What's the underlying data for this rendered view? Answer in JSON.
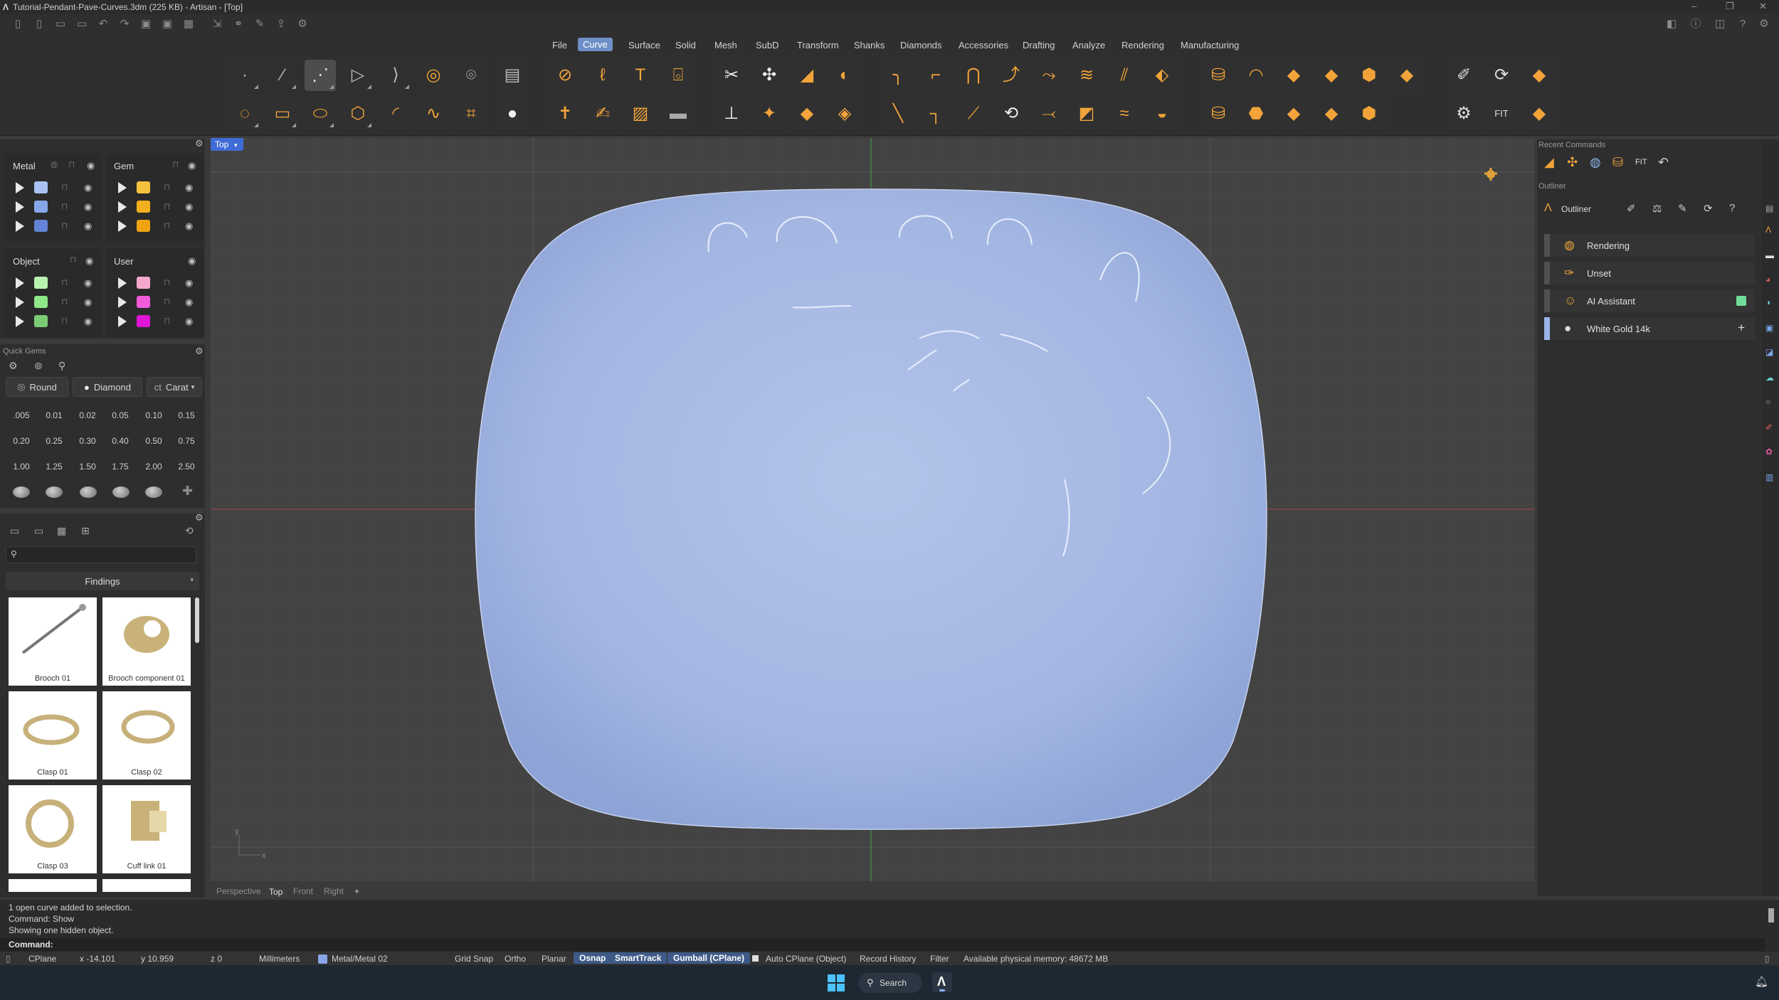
{
  "window": {
    "title": "Tutorial-Pendant-Pave-Curves.3dm (225 KB) - Artisan - [Top]",
    "app_logo": "artisan-logo"
  },
  "menu": {
    "items": [
      "File",
      "Curve",
      "Surface",
      "Solid",
      "Mesh",
      "SubD",
      "Transform",
      "Shanks",
      "Diamonds",
      "Accessories",
      "Drafting",
      "Analyze",
      "Rendering",
      "Manufacturing"
    ],
    "active": "Curve"
  },
  "layers": {
    "metal": {
      "title": "Metal",
      "colors": [
        "#a9c2f2",
        "#86a8ea",
        "#6384d6"
      ]
    },
    "gem": {
      "title": "Gem",
      "colors": [
        "#f6c23e",
        "#f2b01e",
        "#f0a414"
      ]
    },
    "object": {
      "title": "Object",
      "colors": [
        "#b8f3b0",
        "#8fe887",
        "#7ccc74"
      ]
    },
    "user": {
      "title": "User",
      "colors": [
        "#f5a8cc",
        "#f05bd9",
        "#e014d4"
      ]
    }
  },
  "quick_gems": {
    "title": "Quick Gems",
    "shape": "Round",
    "material": "Diamond",
    "unit": "Carat",
    "sizes": [
      ".005",
      "0.01",
      "0.02",
      "0.05",
      "0.10",
      "0.15",
      "0.20",
      "0.25",
      "0.30",
      "0.40",
      "0.50",
      "0.75",
      "1.00",
      "1.25",
      "1.50",
      "1.75",
      "2.00",
      "2.50"
    ]
  },
  "library": {
    "category": "Findings",
    "items": [
      "Brooch 01",
      "Brooch component 01",
      "Clasp 01",
      "Clasp 02",
      "Clasp 03",
      "Cuff link 01"
    ]
  },
  "viewport": {
    "name": "Top",
    "tabs": [
      "Perspective",
      "Top",
      "Front",
      "Right"
    ],
    "active_tab": "Top",
    "add_tab": "+",
    "axis_y": "y",
    "axis_x": "x",
    "shape_color": "#a6bbe6"
  },
  "right_panel": {
    "recent_title": "Recent Commands",
    "outliner_header": "Outliner",
    "outliner_title": "Outliner",
    "rows": [
      {
        "label": "Rendering",
        "icon_color": "#f2a43a"
      },
      {
        "label": "Unset",
        "icon_color": "#f2a43a"
      },
      {
        "label": "AI Assistant",
        "icon_color": "#f2a43a",
        "badge": "#6fdc97"
      },
      {
        "label": "White Gold 14k",
        "icon_color": "#dddddd",
        "add": "+"
      }
    ]
  },
  "command_history": [
    "1 open curve added to selection.",
    "Command: Show",
    "Showing one hidden object."
  ],
  "command_prompt": "Command:",
  "status": {
    "cplane": "CPlane",
    "x": "x -14.101",
    "y": "y 10.959",
    "z": "z 0",
    "units": "Millimeters",
    "layer": "Metal/Metal 02",
    "layer_color": "#8aa6e6",
    "grid_snap": "Grid Snap",
    "ortho": "Ortho",
    "planar": "Planar",
    "osnap": "Osnap",
    "smarttrack": "SmartTrack",
    "gumball": "Gumball (CPlane)",
    "auto_cplane": "Auto CPlane (Object)",
    "record_history": "Record History",
    "filter": "Filter",
    "memory": "Available physical memory: 48672 MB"
  },
  "taskbar": {
    "search": "Search"
  }
}
